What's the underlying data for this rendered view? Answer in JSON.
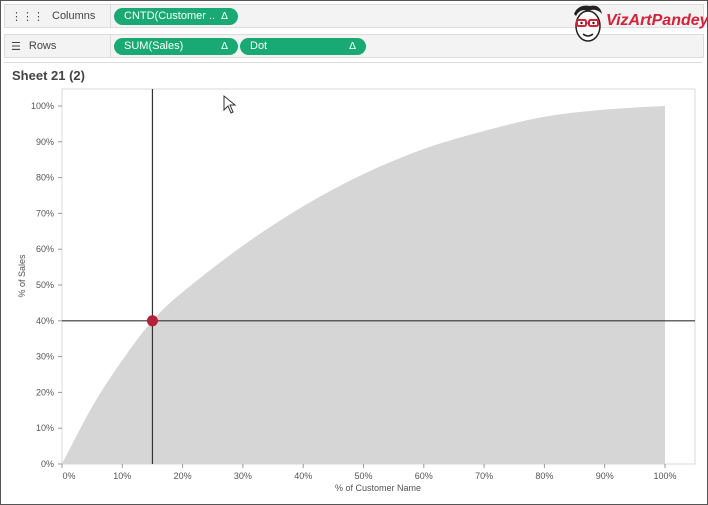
{
  "shelves": {
    "columns": {
      "label": "Columns",
      "icon": "columns-icon",
      "pills": [
        {
          "label": "CNTD(Customer ..",
          "delta": "Δ"
        }
      ]
    },
    "rows": {
      "label": "Rows",
      "icon": "rows-icon",
      "pills": [
        {
          "label": "SUM(Sales)",
          "delta": "Δ"
        },
        {
          "label": "Dot",
          "delta": "Δ"
        }
      ]
    }
  },
  "logo": {
    "text": "VizArtPandey"
  },
  "sheet": {
    "title": "Sheet 21 (2)"
  },
  "colors": {
    "pill": "#19a974",
    "area": "#d6d6d6",
    "marker": "#b5203a",
    "logo": "#d3213a"
  },
  "chart_data": {
    "type": "area",
    "xlabel": "% of Customer Name",
    "ylabel": "% of Sales",
    "x_ticks": [
      "0%",
      "10%",
      "20%",
      "30%",
      "40%",
      "50%",
      "60%",
      "70%",
      "80%",
      "90%",
      "100%"
    ],
    "y_ticks": [
      "0%",
      "10%",
      "20%",
      "30%",
      "40%",
      "50%",
      "60%",
      "70%",
      "80%",
      "90%",
      "100%"
    ],
    "xlim": [
      0,
      100
    ],
    "ylim": [
      0,
      100
    ],
    "series": [
      {
        "x": [
          0,
          5,
          10,
          15,
          20,
          30,
          40,
          50,
          60,
          70,
          80,
          90,
          100
        ],
        "y": [
          0,
          16,
          29,
          40,
          48,
          61,
          72,
          81,
          88,
          93,
          97,
          99,
          100
        ]
      }
    ],
    "reference": {
      "x": 15,
      "y": 40
    }
  }
}
